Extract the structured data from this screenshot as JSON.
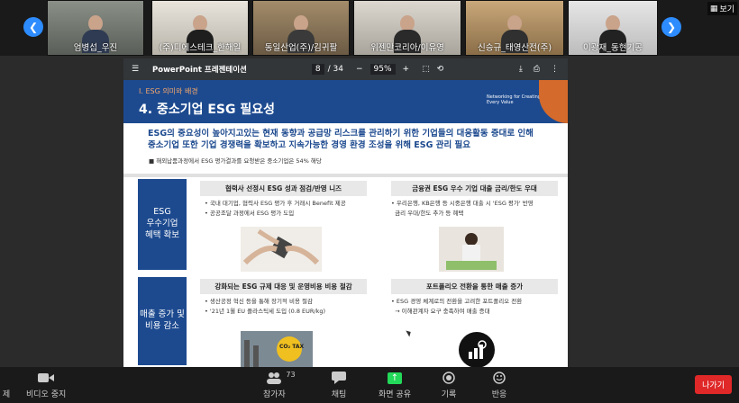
{
  "gallery": {
    "participants": [
      {
        "name": "엄병섭_우진"
      },
      {
        "name": "(주)디에스테크_한해일"
      },
      {
        "name": "동일산업(주)/김귀팔"
      },
      {
        "name": "위젠만코리아/이유영"
      },
      {
        "name": "신승규_태영산전(주)"
      },
      {
        "name": "이광재_동현기공"
      }
    ],
    "view_label": "보기",
    "prev_icon": "chevron-left-icon",
    "next_icon": "chevron-right-icon"
  },
  "presentation": {
    "app_title": "PowerPoint 프레젠테이션",
    "current_page": "8",
    "total_pages": "/ 34",
    "zoom": "95%",
    "zoom_minus": "−",
    "zoom_plus": "+"
  },
  "slide": {
    "section_label": "I. ESG 의미와 배경",
    "title": "4. 중소기업 ESG 필요성",
    "logo_text": "Networking for Creating Every Value",
    "intro_line1": "ESG의 중요성이 높아지고있는 현재 동향과 공급망 리스크를 관리하기 위한 기업들의 대응활동 증대로 인해",
    "intro_line2": "중소기업 또한 기업 경쟁력을 확보하고 지속가능한 경영 환경 조성을 위해 ESG 관리 필요",
    "intro_bullet": "해외납품과정에서 ESG 평가결과를 요청받은 중소기업은 54% 해당",
    "row1_label": "ESG\n우수기업\n혜택 확보",
    "row2_label": "매출 증가 및\n비용 감소",
    "sec1_title": "협력사 선정시 ESG 성과 점검/반영 니즈",
    "sec1_b1": "국내 대기업, 협력사 ESG 평가 후 거래시 Benefit 제공",
    "sec1_b2": "공공조달 과정에서 ESG 평가 도입",
    "sec2_title": "금융권 ESG 우수 기업 대출 금리/한도 우대",
    "sec2_b1": "우리은행, KB은행 등 시중은행 대출 시 'ESG 평가' 반영",
    "sec2_b2": "금리 우대/한도 추가 등 혜택",
    "sec3_title": "강화되는 ESG 규제 대응 및 운영비용 비용 절감",
    "sec3_b1": "생산공정 혁신 등을 통해 장기적 비용 절감",
    "sec3_b2": "'21년 1월 EU 플라스틱세 도입 (0.8 EUR/kg)",
    "sec4_title": "포트폴리오 전환을 통한 매출 증가",
    "sec4_b1": "ESG 경영 체계로의 전환을 고려한 포트폴리오 전환",
    "sec4_b2": "→ 이해관계자 요구 충족하여 매출 증대",
    "img3_text": "CO₂ TAX"
  },
  "toolbar": {
    "left_partial": "제",
    "video_label": "비디오 중지",
    "participants_label": "참가자",
    "participants_count": "73",
    "chat_label": "채팅",
    "share_label": "화면 공유",
    "record_label": "기록",
    "reactions_label": "반응",
    "leave_label": "나가기"
  },
  "colors": {
    "accent": "#2d8cff",
    "slide_blue": "#1d4a8f",
    "slide_orange": "#d46a2b",
    "leave_red": "#e02828",
    "share_green": "#23d959"
  }
}
